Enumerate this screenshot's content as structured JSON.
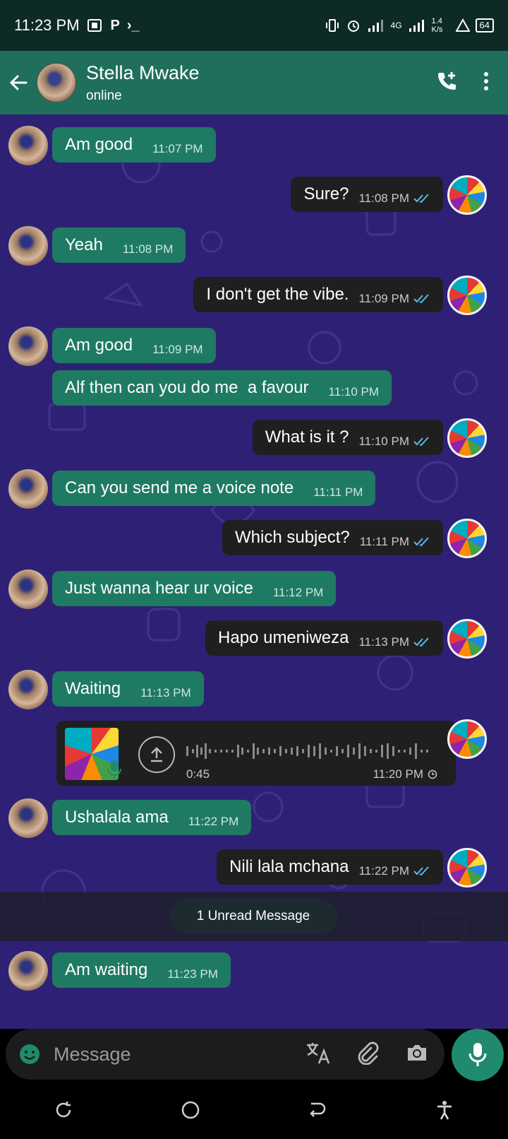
{
  "status_bar": {
    "time": "11:23 PM",
    "left_glyphs": [
      "P",
      "›_"
    ],
    "network": "4G",
    "speed": "1.4 K/s",
    "battery": "64"
  },
  "header": {
    "contact_name": "Stella Mwake",
    "contact_status": "online",
    "back_icon": "arrow-left-icon",
    "call_icon": "add-call-icon",
    "menu_icon": "more-vert-icon"
  },
  "messages": [
    {
      "dir": "in",
      "text": "Am good",
      "time": "11:07 PM"
    },
    {
      "dir": "out",
      "text": "Sure?",
      "time": "11:08 PM"
    },
    {
      "dir": "in",
      "text": "Yeah",
      "time": "11:08 PM"
    },
    {
      "dir": "out",
      "text": "I don't get the vibe.",
      "time": "11:09 PM"
    },
    {
      "dir": "in",
      "text": "Am good",
      "time": "11:09 PM"
    },
    {
      "dir": "in",
      "text": "Alf then can you do me  a favour",
      "time": "11:10 PM"
    },
    {
      "dir": "out",
      "text": "What is it ?",
      "time": "11:10 PM"
    },
    {
      "dir": "in",
      "text": "Can you send me a voice note",
      "time": "11:11 PM"
    },
    {
      "dir": "out",
      "text": "Which subject?",
      "time": "11:11 PM"
    },
    {
      "dir": "in",
      "text": "Just wanna hear ur voice",
      "time": "11:12 PM"
    },
    {
      "dir": "out",
      "text": "Hapo umeniweza",
      "time": "11:13 PM"
    },
    {
      "dir": "in",
      "text": "Waiting",
      "time": "11:13 PM"
    },
    {
      "dir": "in",
      "text": "Ushalala ama",
      "time": "11:22 PM"
    },
    {
      "dir": "out",
      "text": "Nili lala mchana",
      "time": "11:22 PM"
    },
    {
      "dir": "in",
      "text": "Am waiting",
      "time": "11:23 PM"
    }
  ],
  "voice_note": {
    "duration": "0:45",
    "time": "11:20 PM",
    "status": "pending"
  },
  "unread_banner": "1 Unread Message",
  "composer": {
    "placeholder": "Message",
    "icons": [
      "emoji-icon",
      "translate-icon",
      "attach-icon",
      "camera-icon",
      "mic-icon"
    ]
  },
  "colors": {
    "header_bg": "#1f6f5c",
    "incoming_bubble": "#1f7a63",
    "outgoing_bubble": "#1f1f1f",
    "chat_bg": "#2e2175",
    "read_tick": "#53bdeb"
  }
}
